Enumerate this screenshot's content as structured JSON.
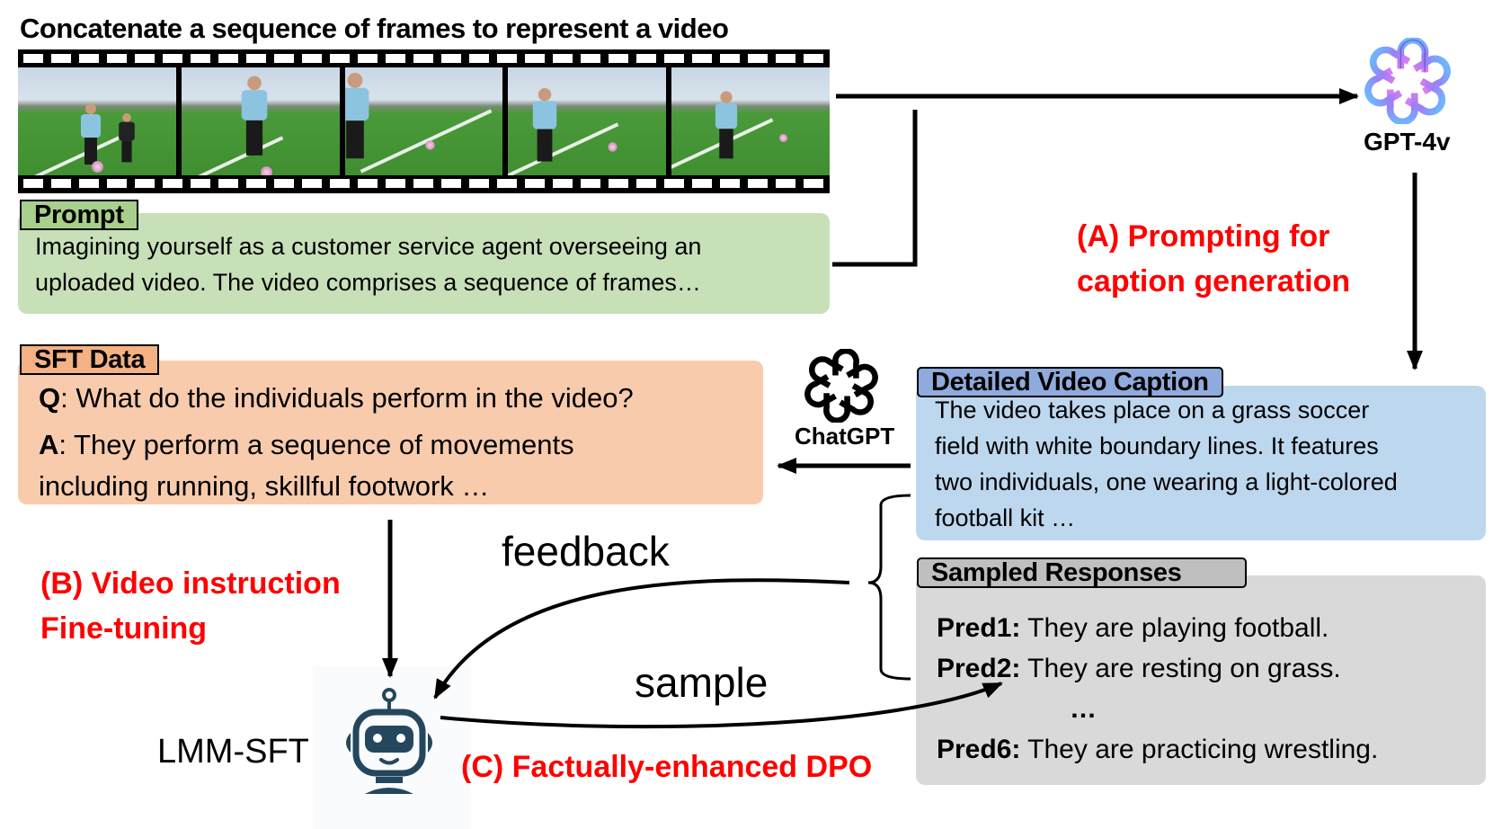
{
  "title": "Concatenate a sequence of frames to represent a video",
  "video_frames": {
    "count": 5,
    "frames": [
      {
        "description": "player dribbling ball with second player behind"
      },
      {
        "description": "player with ball close-up"
      },
      {
        "description": "player kicking, ball in distance"
      },
      {
        "description": "player running toward ball"
      },
      {
        "description": "player running, ball ahead"
      }
    ]
  },
  "prompt": {
    "tag": "Prompt",
    "lines": [
      "Imagining yourself as a customer service agent overseeing an",
      "uploaded video. The video comprises a sequence of frames…"
    ]
  },
  "gpt4v": {
    "icon": "openai-logo-icon",
    "label": "GPT-4v"
  },
  "stage_a": {
    "lines": [
      "(A) Prompting for",
      "caption generation"
    ]
  },
  "caption": {
    "tag": "Detailed Video Caption",
    "lines": [
      "The video takes place on a grass soccer",
      "field with white boundary lines. It features",
      "two individuals, one wearing a light-colored",
      "football kit …"
    ]
  },
  "chatgpt": {
    "icon": "openai-logo-icon",
    "label": "ChatGPT"
  },
  "sft": {
    "tag": "SFT Data",
    "q_label": "Q",
    "q_text": ": What do the individuals perform in the video?",
    "a_label": "A",
    "a_text_1": ": They perform a sequence of movements",
    "a_text_2": "including running, skillful footwork …"
  },
  "stage_b": {
    "lines": [
      "(B) Video instruction",
      "Fine-tuning"
    ]
  },
  "stage_c": {
    "label": "(C) Factually-enhanced DPO"
  },
  "model": {
    "icon": "robot-icon",
    "label": "LMM-SFT"
  },
  "edges": {
    "feedback": "feedback",
    "sample": "sample"
  },
  "sampled": {
    "tag": "Sampled Responses",
    "preds": [
      {
        "label": "Pred1:",
        "text": " They are playing football."
      },
      {
        "label": "Pred2:",
        "text": " They are resting on grass."
      },
      {
        "label": "",
        "text": "…"
      },
      {
        "label": "Pred6:",
        "text": " They are practicing wrestling."
      }
    ]
  },
  "colors": {
    "prompt_bg": "#c8e0b8",
    "prompt_tag": "#a8d08d",
    "sft_bg": "#f8cbad",
    "sft_tag": "#f4b183",
    "caption_bg": "#bdd7ee",
    "caption_tag": "#8faadc",
    "sampled_bg": "#d9d9d9",
    "sampled_tag": "#bfbfbf",
    "stage_label": "#ff0000",
    "robot": "#24475e"
  }
}
